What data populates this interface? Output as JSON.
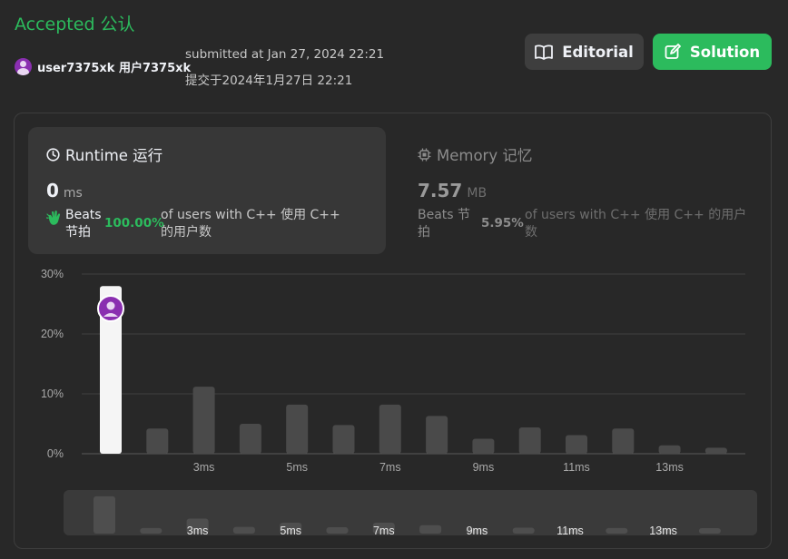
{
  "header": {
    "status": "Accepted 公认",
    "username": "user7375xk 用户7375xk",
    "submitted_en": "submitted at Jan 27, 2024 22:21",
    "submitted_zh": "提交于2024年1月27日 22:21"
  },
  "buttons": {
    "editorial": "Editorial",
    "solution": "Solution"
  },
  "runtime": {
    "title": "Runtime 运行",
    "value": "0",
    "unit": "ms",
    "beats_label": "Beats 节拍",
    "beats_pct": "100.00%",
    "beats_text": "of users with C++ 使用 C++ 的用户数"
  },
  "memory": {
    "title": "Memory 记忆",
    "value": "7.57",
    "unit": "MB",
    "beats_label": "Beats 节拍",
    "beats_pct": "5.95%",
    "beats_text": "of users with C++ 使用 C++ 的用户数"
  },
  "colors": {
    "accent": "#2cbb5d",
    "bar": "#4a4a4a",
    "highlight_bar": "#f5f5f5",
    "avatar": "#8a2fb0"
  },
  "chart_data": {
    "type": "bar",
    "yticks": [
      "0%",
      "10%",
      "20%",
      "30%"
    ],
    "ylim": [
      0,
      30
    ],
    "x": [
      0,
      1,
      2,
      3,
      4,
      5,
      6,
      7,
      8,
      9,
      10,
      11,
      12,
      13,
      14
    ],
    "values": [
      28,
      4.2,
      11.2,
      5.0,
      8.2,
      4.8,
      8.2,
      6.3,
      2.5,
      4.4,
      3.1,
      4.2,
      1.4,
      1.0
    ],
    "highlight_index": 0,
    "xtick_labels": [
      "3ms",
      "5ms",
      "7ms",
      "9ms",
      "11ms",
      "13ms"
    ],
    "xtick_positions": [
      2,
      4,
      6,
      8,
      10,
      12
    ],
    "grid": true
  }
}
